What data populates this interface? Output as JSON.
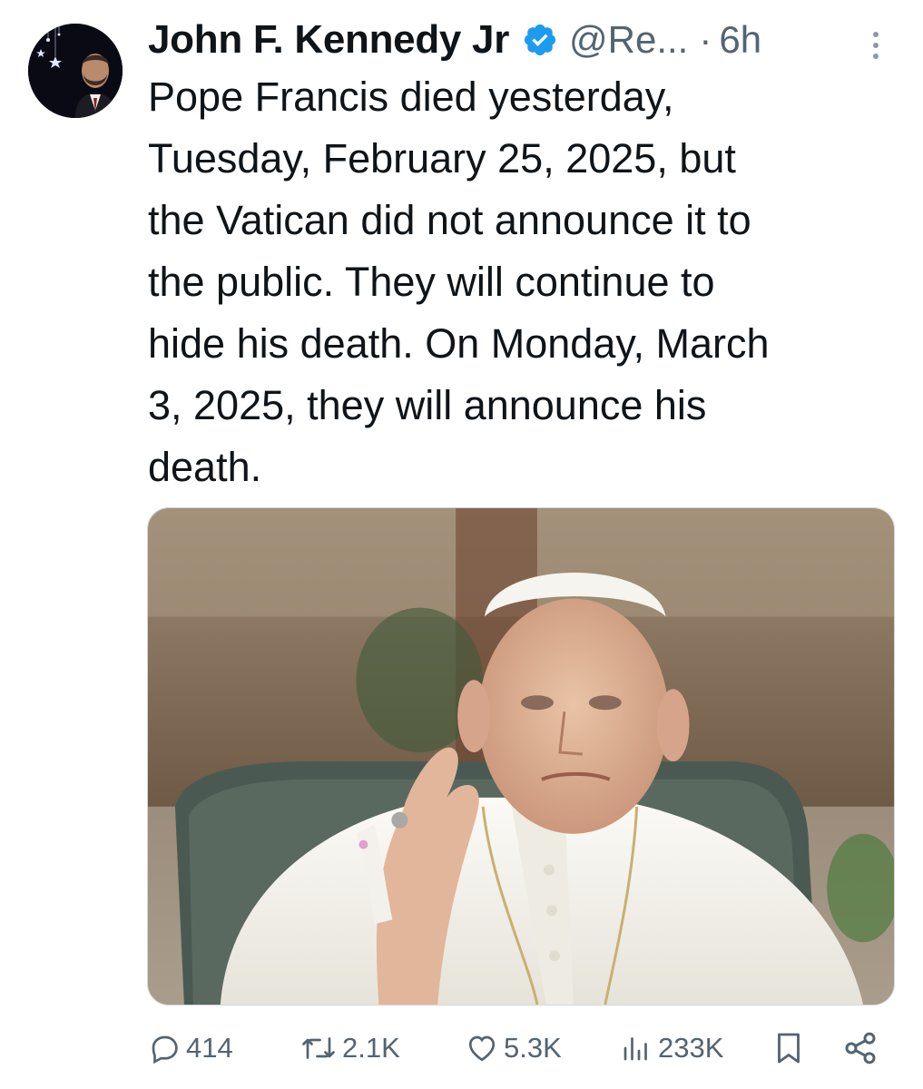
{
  "tweet": {
    "author": {
      "display_name": "John F. Kennedy Jr",
      "handle": "@Re...",
      "verified": true,
      "verified_color": "#1d9bf0"
    },
    "separator": "·",
    "timestamp": "6h",
    "text": "Pope Francis died yesterday,\nTuesday, February 25, 2025, but\nthe Vatican did not announce it to\nthe public. They will continue to\nhide his death. On Monday, March\n3, 2025, they will announce his\ndeath.",
    "media": {
      "kind": "photo"
    },
    "actions": {
      "replies": "414",
      "retweets": "2.1K",
      "likes": "5.3K",
      "views": "233K"
    }
  },
  "icons": {
    "reply": "reply-icon",
    "retweet": "retweet-icon",
    "like": "heart-icon",
    "views": "views-icon",
    "bookmark": "bookmark-icon",
    "share": "share-icon",
    "more": "more-vertical-icon",
    "verified": "verified-badge-icon"
  },
  "colors": {
    "text_primary": "#0f1419",
    "text_secondary": "#536471",
    "accent": "#1d9bf0"
  }
}
